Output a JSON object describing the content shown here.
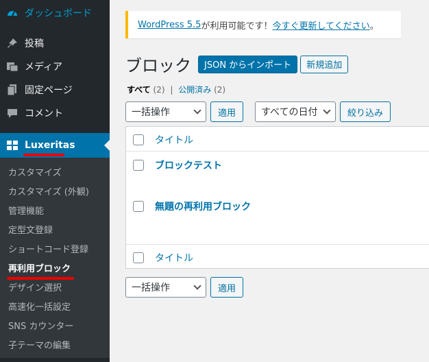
{
  "sidebar": {
    "dashboard": {
      "label": "ダッシュボード",
      "icon": "dashboard-icon"
    },
    "items": [
      {
        "label": "投稿",
        "icon": "pin-icon"
      },
      {
        "label": "メディア",
        "icon": "media-icon"
      },
      {
        "label": "固定ページ",
        "icon": "page-icon"
      },
      {
        "label": "コメント",
        "icon": "comment-icon"
      }
    ],
    "luxeritas": {
      "label": "Luxeritas",
      "icon": "grid-icon"
    },
    "submenu": [
      {
        "label": "カスタマイズ"
      },
      {
        "label": "カスタマイズ (外観)"
      },
      {
        "label": "管理機能"
      },
      {
        "label": "定型文登録"
      },
      {
        "label": "ショートコード登録"
      },
      {
        "label": "再利用ブロック"
      },
      {
        "label": "デザイン選択"
      },
      {
        "label": "高速化一括設定"
      },
      {
        "label": "SNS カウンター"
      },
      {
        "label": "子テーマの編集"
      }
    ]
  },
  "notice": {
    "version_link": "WordPress 5.5",
    "text": " が利用可能です！",
    "update_link": "今すぐ更新してください",
    "suffix": "。"
  },
  "header": {
    "title": "ブロック",
    "import_button": "JSON からインポート",
    "add_button": "新規追加"
  },
  "filters": {
    "all_label": "すべて",
    "all_count": "(2)",
    "separator": "|",
    "published_label": "公開済み",
    "published_count": "(2)"
  },
  "top_actions": {
    "bulk_select": "一括操作",
    "apply": "適用",
    "date_select": "すべての日付",
    "filter_button": "絞り込み"
  },
  "table": {
    "column_title": "タイトル",
    "rows": [
      {
        "title": "ブロックテスト"
      },
      {
        "title": "無題の再利用ブロック"
      }
    ],
    "footer_title": "タイトル"
  },
  "bottom_actions": {
    "bulk_select": "一括操作",
    "apply": "適用"
  },
  "colors": {
    "sidebar_bg": "#23282d",
    "accent": "#0073aa",
    "notice_border": "#ffb900",
    "annotation": "#ee0000"
  }
}
